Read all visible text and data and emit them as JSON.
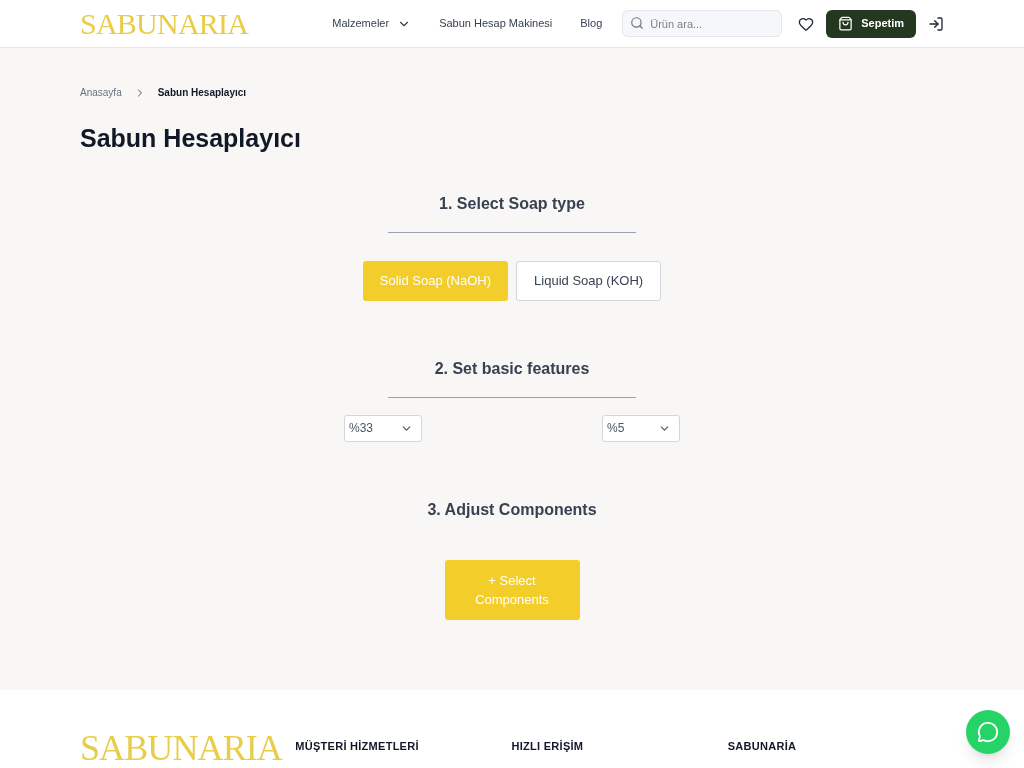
{
  "header": {
    "logo": "SABUNARIA",
    "nav": [
      {
        "label": "Malzemeler",
        "dropdown": true
      },
      {
        "label": "Sabun Hesap Makinesi",
        "dropdown": false
      },
      {
        "label": "Blog",
        "dropdown": false
      }
    ],
    "search": {
      "placeholder": "Ürün ara..."
    },
    "cart": "Sepetim"
  },
  "breadcrumb": [
    "Anasayfa",
    "Sabun Hesaplayıcı"
  ],
  "title": "Sabun Hesaplayıcı",
  "step1": {
    "heading": "1. Select Soap type",
    "options": [
      {
        "label": "Solid Soap (NaOH)",
        "selected": true
      },
      {
        "label": "Liquid Soap (KOH)",
        "selected": false
      }
    ]
  },
  "step2": {
    "heading": "2. Set basic features",
    "selects": [
      "%33",
      "%5"
    ]
  },
  "step3": {
    "heading": "3. Adjust Components",
    "button": "+ Select Components"
  },
  "footer": {
    "logo": "SABUNARIA",
    "columns": [
      "MÜŞTERİ HİZMETLERİ",
      "HIZLI ERİŞİM",
      "SABUNARİA"
    ]
  }
}
